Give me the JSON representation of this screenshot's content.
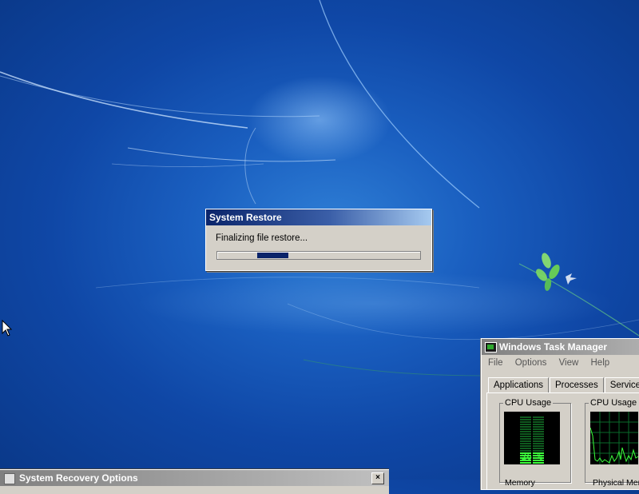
{
  "system_restore": {
    "title": "System Restore",
    "message": "Finalizing file restore...",
    "progress": 0.16
  },
  "task_manager": {
    "title": "Windows Task Manager",
    "menu": [
      "File",
      "Options",
      "View",
      "Help"
    ],
    "tabs": [
      "Applications",
      "Processes",
      "Services"
    ],
    "cpu_usage_label": "CPU Usage",
    "cpu_usage_value": "26 %",
    "cpu_history_label": "CPU Usage H",
    "memory_label": "Memory",
    "physical_memory_label": "Physical Mem"
  },
  "recovery_options": {
    "title": "System Recovery Options"
  }
}
